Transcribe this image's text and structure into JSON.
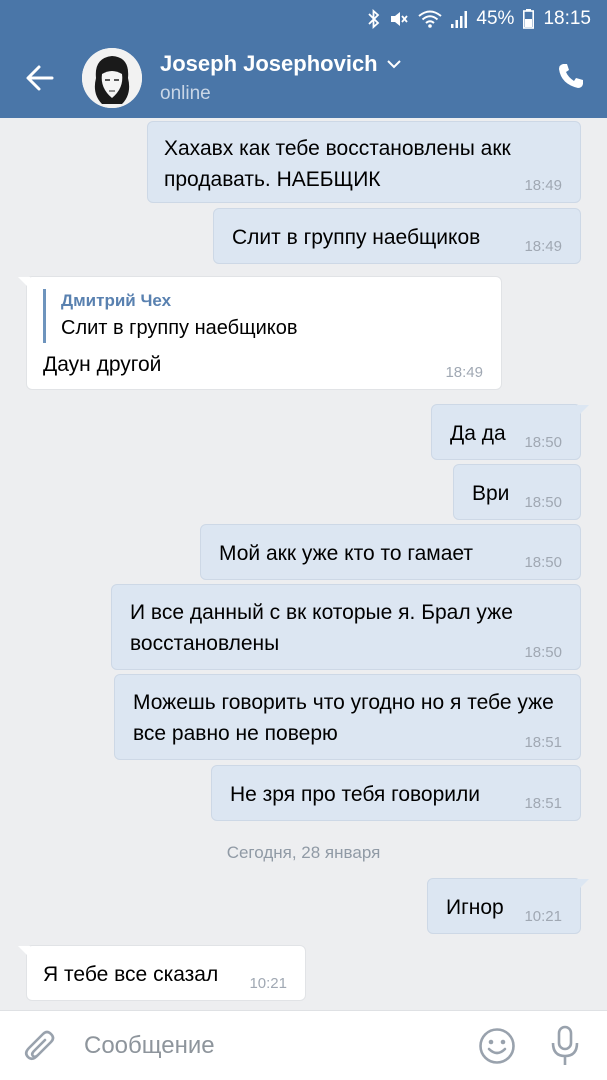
{
  "status_bar": {
    "battery": "45%",
    "time": "18:15"
  },
  "header": {
    "name": "Joseph Josephovich",
    "status": "online",
    "icons": [
      "back-arrow-icon",
      "chevron-down-icon",
      "phone-icon"
    ]
  },
  "colors": {
    "header": "#4a76a8",
    "out_bubble": "#dce6f2",
    "in_bubble": "#ffffff",
    "background": "#edeef0",
    "reply_name": "#5981b0"
  },
  "messages": [
    {
      "dir": "out",
      "text": "Хахавх как тебе восстановлены акк продавать. НАЕБЩИК",
      "time": "18:49"
    },
    {
      "dir": "out",
      "text": "Слит в группу наебщиков",
      "time": "18:49"
    },
    {
      "dir": "in",
      "reply_author": "Дмитрий Чех",
      "reply_text": "Слит в группу наебщиков",
      "text": "Даун другой",
      "time": "18:49"
    },
    {
      "dir": "out",
      "text": "Да да",
      "time": "18:50"
    },
    {
      "dir": "out",
      "text": "Ври",
      "time": "18:50"
    },
    {
      "dir": "out",
      "text": "Мой акк уже кто то гамает",
      "time": "18:50"
    },
    {
      "dir": "out",
      "text": "И все данный с вк которые я. Брал уже восстановлены",
      "time": "18:50"
    },
    {
      "dir": "out",
      "text": "Можешь говорить что угодно но я тебе уже все равно не поверю",
      "time": "18:51"
    },
    {
      "dir": "out",
      "text": "Не зря про тебя говорили",
      "time": "18:51"
    },
    {
      "dir": "out",
      "text": "Игнор",
      "time": "10:21"
    },
    {
      "dir": "in",
      "text": "Я тебе все сказал",
      "time": "10:21"
    }
  ],
  "date_separator": "Сегодня, 28 января",
  "input": {
    "placeholder": "Сообщение",
    "value": ""
  }
}
